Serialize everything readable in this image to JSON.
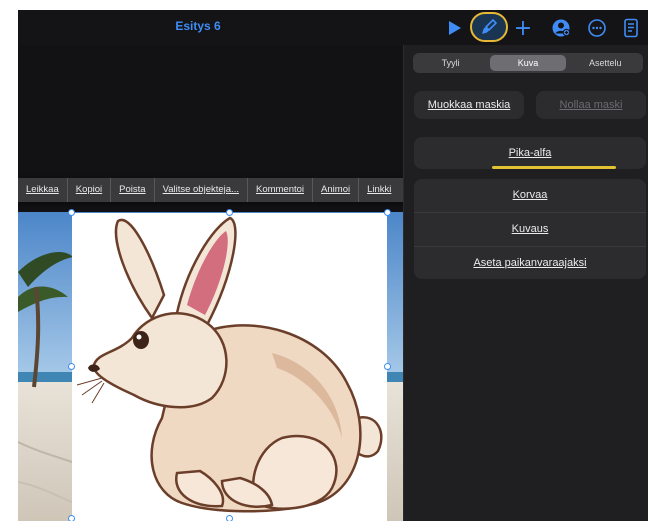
{
  "document": {
    "title": "Esitys 6"
  },
  "toolbar": {
    "icons": [
      "play-icon",
      "paintbrush-icon",
      "plus-icon",
      "collaborate-icon",
      "more-icon",
      "document-icon"
    ],
    "add_glyph": "+",
    "accent_color": "#3f8cf7",
    "highlight_color": "#e7b833"
  },
  "context_menu": {
    "items": [
      "Leikkaa",
      "Kopioi",
      "Poista",
      "Valitse objekteja...",
      "Kommentoi",
      "Animoi",
      "Linkki"
    ]
  },
  "inspector": {
    "tabs": [
      "Tyyli",
      "Kuva",
      "Asettelu"
    ],
    "active_tab": "Kuva",
    "edit_mask": "Muokkaa maskia",
    "reset_mask": "Nollaa maski",
    "instant_alpha": "Pika-alfa",
    "replace": "Korvaa",
    "description": "Kuvaus",
    "set_placeholder": "Aseta paikanvaraajaksi"
  }
}
